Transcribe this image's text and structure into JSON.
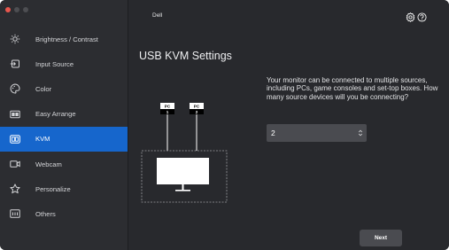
{
  "window": {
    "title": "Dell"
  },
  "sidebar": {
    "items": [
      {
        "label": "Brightness / Contrast",
        "icon": "brightness-icon",
        "active": false
      },
      {
        "label": "Input Source",
        "icon": "input-source-icon",
        "active": false
      },
      {
        "label": "Color",
        "icon": "color-icon",
        "active": false
      },
      {
        "label": "Easy Arrange",
        "icon": "easy-arrange-icon",
        "active": false
      },
      {
        "label": "KVM",
        "icon": "kvm-icon",
        "active": true
      },
      {
        "label": "Webcam",
        "icon": "webcam-icon",
        "active": false
      },
      {
        "label": "Personalize",
        "icon": "star-icon",
        "active": false
      },
      {
        "label": "Others",
        "icon": "others-icon",
        "active": false
      }
    ]
  },
  "main": {
    "page_title": "USB KVM Settings",
    "question": "Your monitor can be connected to multiple sources, including PCs, game consoles and set-top boxes. How many source devices will you be connecting?",
    "select_value": "2",
    "next_label": "Next",
    "diagram": {
      "pcs": [
        {
          "label": "PC",
          "number": "1"
        },
        {
          "label": "PC",
          "number": "2"
        }
      ]
    }
  },
  "colors": {
    "accent": "#1666cc",
    "sidebar_bg": "#2c2d31",
    "main_bg": "#28292d",
    "control_bg": "#4a4b50"
  }
}
